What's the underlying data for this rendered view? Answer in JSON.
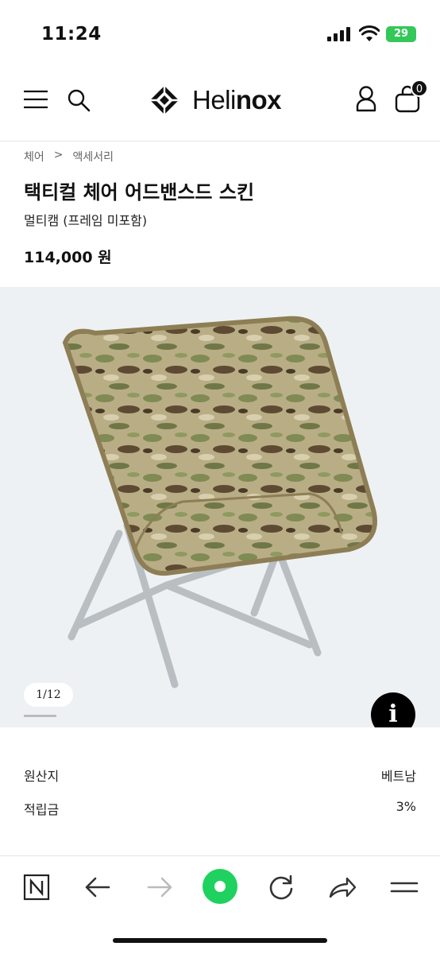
{
  "status_bar": {
    "time": "11:24",
    "battery": "29"
  },
  "header": {
    "logo_text_regular": "Heli",
    "logo_text_bold": "nox",
    "cart_count": "0"
  },
  "breadcrumb": {
    "items": [
      "체어",
      "액세서리"
    ],
    "separator": ">"
  },
  "product": {
    "title": "택티컬 체어 어드밴스드 스킨",
    "subtitle": "멀티캠 (프레임 미포함)",
    "price": "114,000 원"
  },
  "gallery": {
    "counter": "1/12",
    "info_label": "i"
  },
  "specs": [
    {
      "label": "원산지",
      "value": "베트남"
    },
    {
      "label": "적립금",
      "value": "3%"
    }
  ],
  "colors": {
    "accent_green": "#1fd15e",
    "battery_green": "#34c759"
  },
  "toolbar": {
    "icons": [
      "naver-n-icon",
      "back-arrow-icon",
      "forward-arrow-icon",
      "green-dot-icon",
      "reload-icon",
      "share-icon",
      "menu-lines-icon"
    ]
  }
}
